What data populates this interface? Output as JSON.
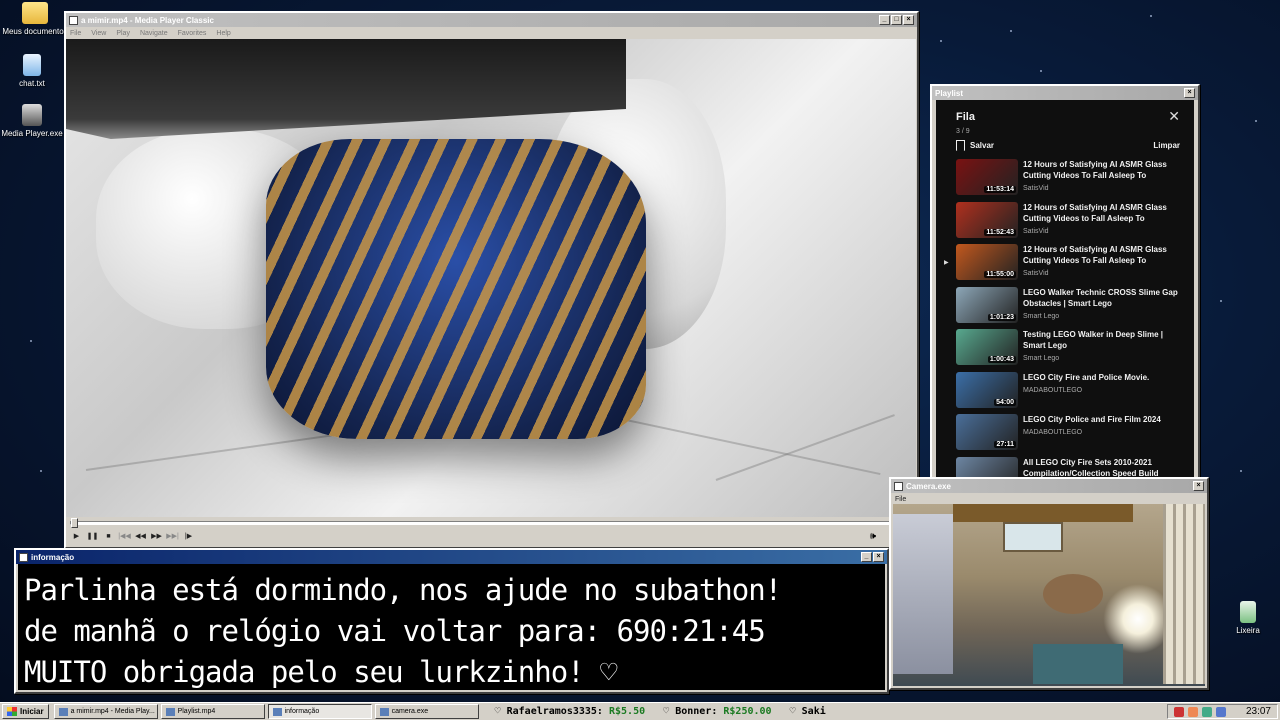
{
  "desktop": {
    "icons": [
      {
        "label": "Meus documentos",
        "icon": "documents-folder-icon"
      },
      {
        "label": "chat.txt",
        "icon": "text-file-icon"
      },
      {
        "label": "Media Player.exe",
        "icon": "media-player-icon"
      },
      {
        "label": "Lixeira",
        "icon": "recycle-bin-icon"
      }
    ]
  },
  "player": {
    "title": "a mimir.mp4 - Media Player Classic",
    "menu": [
      "File",
      "View",
      "Play",
      "Navigate",
      "Favorites",
      "Help"
    ],
    "progress": 0.0
  },
  "playlist": {
    "window_title": "Playlist",
    "heading": "Fila",
    "count": "3 / 9",
    "save_label": "Salvar",
    "clear_label": "Limpar",
    "current_index": 2,
    "items": [
      {
        "title": "12 Hours of Satisfying AI ASMR Glass Cutting Videos To Fall Asleep To",
        "channel": "SatisVid",
        "duration": "11:53:14",
        "thumb": "#7a1212"
      },
      {
        "title": "12 Hours of Satisfying AI ASMR Glass Cutting Videos to Fall Asleep To",
        "channel": "SatisVid",
        "duration": "11:52:43",
        "thumb": "#b0301e"
      },
      {
        "title": "12 Hours of Satisfying AI ASMR Glass Cutting Videos To Fall Asleep To",
        "channel": "SatisVid",
        "duration": "11:55:00",
        "thumb": "#c2581e"
      },
      {
        "title": "LEGO Walker Technic CROSS Slime Gap Obstacles | Smart Lego",
        "channel": "Smart Lego",
        "duration": "1:01:23",
        "thumb": "#8da7b8"
      },
      {
        "title": "Testing LEGO Walker in Deep Slime | Smart Lego",
        "channel": "Smart Lego",
        "duration": "1:00:43",
        "thumb": "#58a98f"
      },
      {
        "title": "LEGO City Fire and Police Movie.",
        "channel": "MADABOUTLEGO",
        "duration": "54:00",
        "thumb": "#3b6fa8"
      },
      {
        "title": "LEGO City Police and Fire Film 2024",
        "channel": "MADABOUTLEGO",
        "duration": "27:11",
        "thumb": "#4a6f9a"
      },
      {
        "title": "All LEGO City Fire Sets 2010-2021 Compilation/Collection Speed Build",
        "channel": "",
        "duration": "",
        "thumb": "#6d86a3"
      }
    ]
  },
  "info": {
    "window_title": "informação",
    "line1": "Parlinha está dormindo, nos ajude no subathon!",
    "line2": "de manhã o relógio vai voltar para:  690:21:45",
    "line3": "MUITO obrigada pelo seu lurkzinho! ♡"
  },
  "camera": {
    "window_title": "Camera.exe",
    "menu": "File"
  },
  "taskbar": {
    "start_label": "Iniciar",
    "tasks": [
      "a mimir.mp4 - Media Play...",
      "Playlist.mp4",
      "informação",
      "camera.exe"
    ],
    "active_task_index": 2,
    "ticker": [
      {
        "name": "♡ Rafaelramos3335:",
        "amount": "R$5.50"
      },
      {
        "name": "♡ Bonner:",
        "amount": "R$250.00"
      },
      {
        "name": "♡ Saki",
        "amount": ""
      }
    ],
    "clock": "23:07"
  }
}
